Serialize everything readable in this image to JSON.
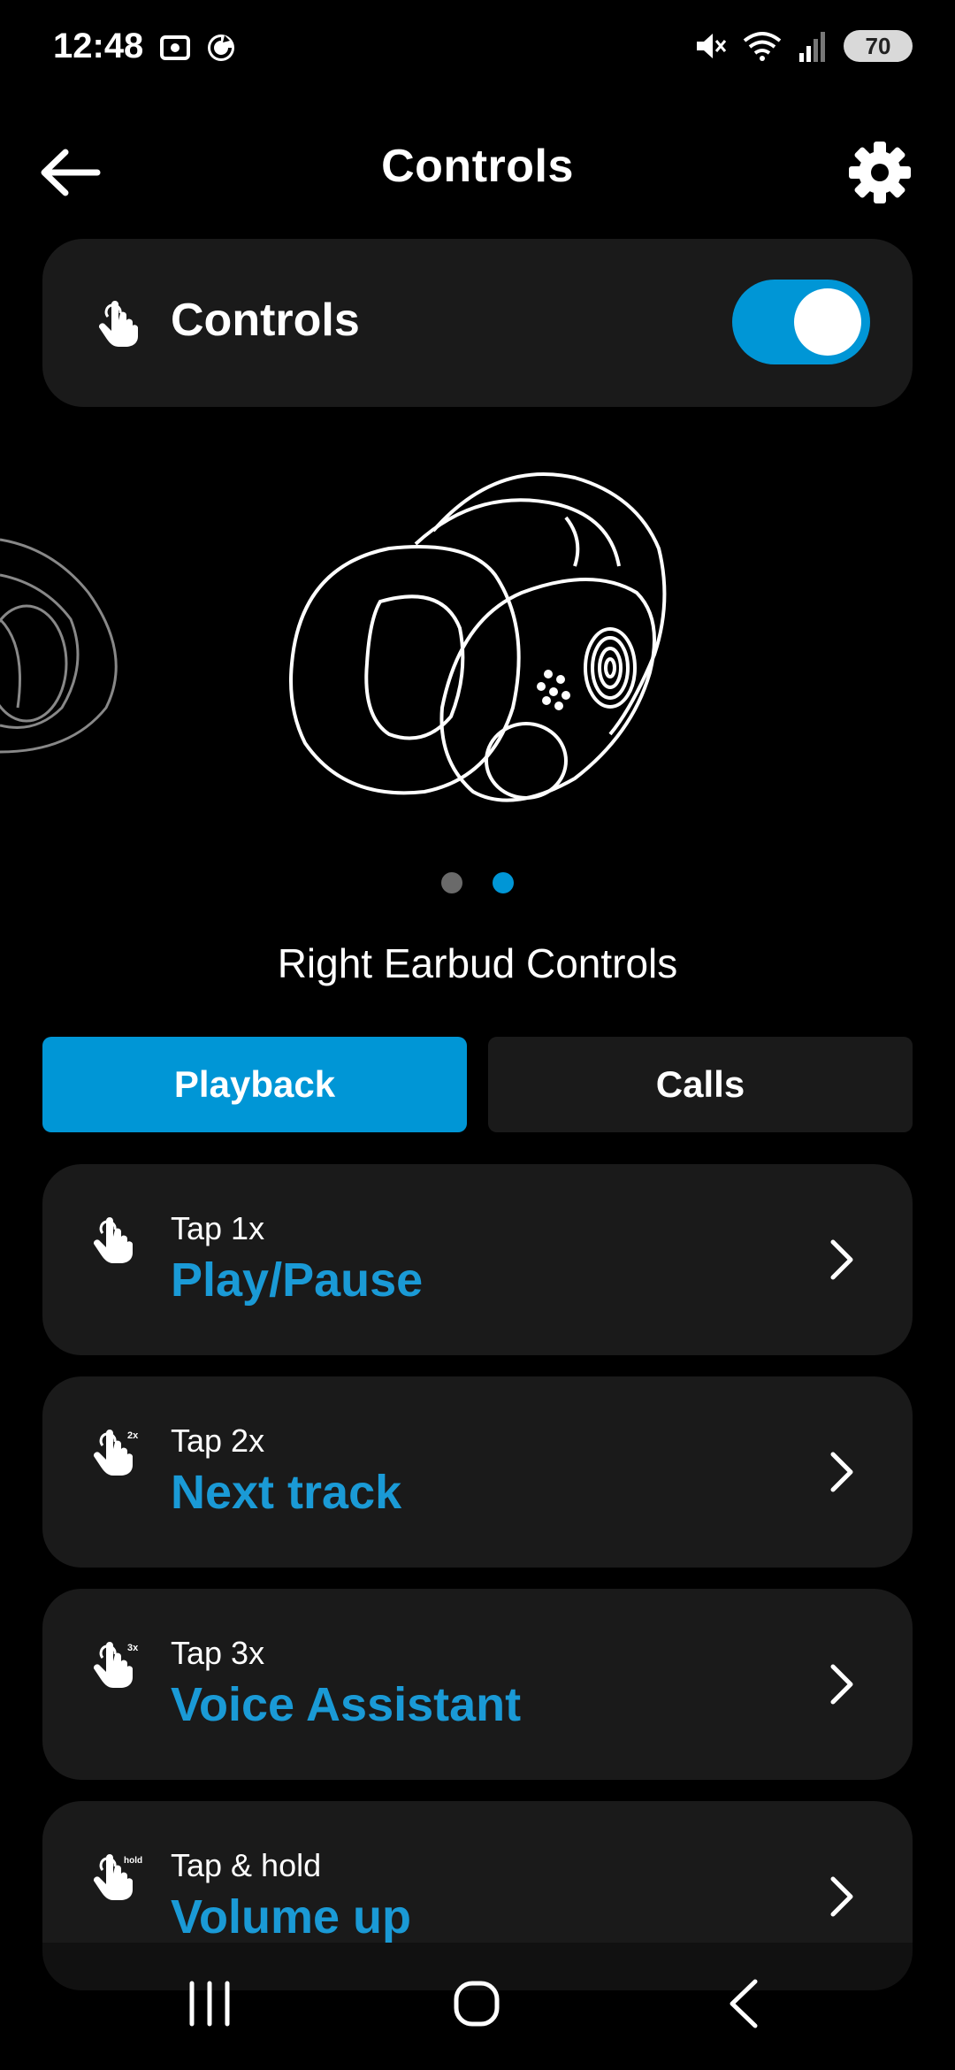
{
  "status": {
    "time": "12:48",
    "battery": "70",
    "icons_left": [
      "screenshot-icon",
      "sync-icon"
    ],
    "icons_right": [
      "mute-icon",
      "wifi-icon",
      "signal-icon",
      "battery-icon"
    ]
  },
  "header": {
    "title": "Controls",
    "back_icon": "back-arrow-icon",
    "settings_icon": "gear-icon"
  },
  "controls_card": {
    "label": "Controls",
    "icon": "hand-tap-icon",
    "enabled": true
  },
  "carousel": {
    "page_count": 2,
    "active_page": 2
  },
  "section_title": "Right Earbud Controls",
  "tabs": [
    {
      "label": "Playback",
      "active": true
    },
    {
      "label": "Calls",
      "active": false
    }
  ],
  "gestures": [
    {
      "gesture": "Tap 1x",
      "action": "Play/Pause",
      "badge": ""
    },
    {
      "gesture": "Tap 2x",
      "action": "Next track",
      "badge": "2x"
    },
    {
      "gesture": "Tap 3x",
      "action": "Voice Assistant",
      "badge": "3x"
    },
    {
      "gesture": "Tap & hold",
      "action": "Volume up",
      "badge": "hold"
    }
  ],
  "colors": {
    "accent": "#0096d6",
    "action_text": "#1a9ad6",
    "card_bg": "#1a1a1a",
    "background": "#000000"
  }
}
